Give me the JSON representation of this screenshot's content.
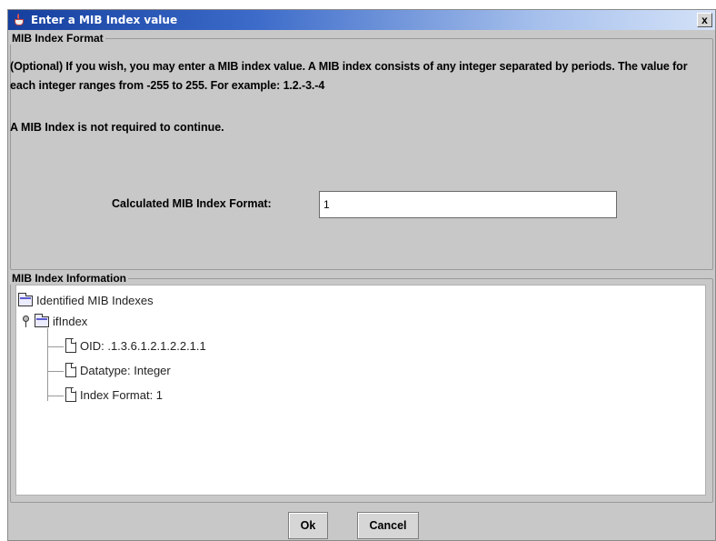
{
  "window": {
    "title": "Enter a MIB Index value",
    "close_glyph": "x"
  },
  "format_group": {
    "legend": "MIB Index Format",
    "description": "(Optional) If you wish, you may enter a MIB index value. A MIB index consists of any integer separated by periods. The value for each integer ranges from -255 to 255. For example: 1.2.-3.-4",
    "not_required": "A MIB Index is not required to continue.",
    "calc_label": "Calculated MIB Index Format:",
    "calc_value": "1"
  },
  "info_group": {
    "legend": "MIB Index Information",
    "tree": {
      "root": "Identified MIB Indexes",
      "node": "ifIndex",
      "children": [
        "OID: .1.3.6.1.2.1.2.2.1.1",
        "Datatype: Integer",
        "Index Format: 1"
      ]
    }
  },
  "buttons": {
    "ok": "Ok",
    "cancel": "Cancel"
  },
  "icons": {
    "title": "java-cup-icon",
    "folder": "folder-icon",
    "document": "document-icon",
    "toggle": "tree-handle-icon"
  }
}
